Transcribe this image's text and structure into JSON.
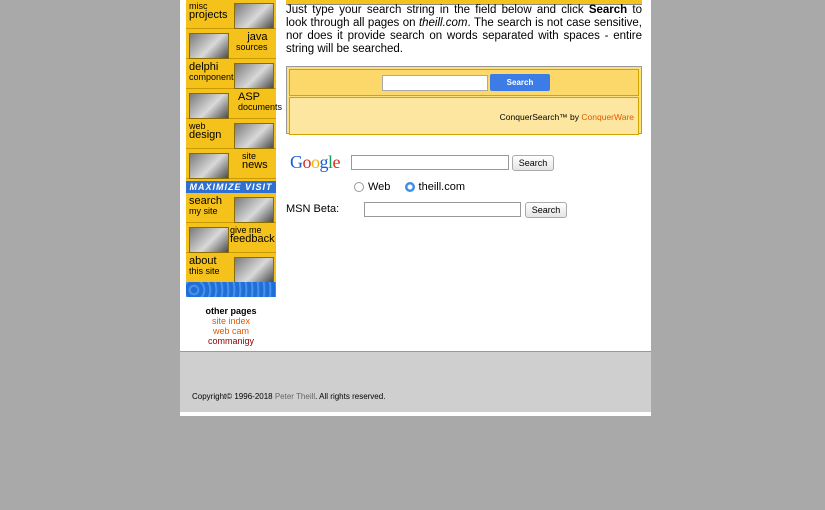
{
  "nav": {
    "items": [
      {
        "line1": "misc",
        "line2": "projects",
        "side": "left"
      },
      {
        "line1": "java",
        "line2": "sources",
        "side": "right"
      },
      {
        "line1": "delphi",
        "line2": "components",
        "side": "left"
      },
      {
        "line1": "ASP",
        "line2": "documents",
        "side": "right"
      },
      {
        "line1": "web",
        "line2": "design",
        "side": "left"
      },
      {
        "line1": "site",
        "line2": "news",
        "side": "right"
      }
    ],
    "banner": "MAXIMIZE VISIT",
    "items2": [
      {
        "line1": "search",
        "line2": "my site",
        "side": "left"
      },
      {
        "line1": "give me",
        "line2": "feedback",
        "side": "right"
      },
      {
        "line1": "about",
        "line2": "this site",
        "side": "left"
      }
    ]
  },
  "other_pages": {
    "title": "other pages",
    "links": [
      "site index",
      "web cam",
      "commanigy"
    ]
  },
  "intro": {
    "part1": "Just type your search string in the field below and click ",
    "bold": "Search",
    "part2": " to look through all pages on ",
    "italic": "theill.com",
    "part3": ". The search is not case sensitive, nor does it provide search on words separated with spaces - entire string will be searched."
  },
  "conquer": {
    "button": "Search",
    "credit_prefix": "ConquerSearch™ by ",
    "credit_brand": "ConquerWare"
  },
  "google": {
    "logo": "Google",
    "button": "Search",
    "radio_web": "Web",
    "radio_site": "theill.com",
    "selected": "theill.com"
  },
  "msn": {
    "label": "MSN Beta:",
    "button": "Search"
  },
  "footer": {
    "prefix": "Copyright© 1996-2018 ",
    "name": "Peter Theill",
    "suffix": ". All rights reserved."
  },
  "colors": {
    "background": "#a9a9a9",
    "nav_yellow": "#f4c21a",
    "accent_blue": "#3d7be6",
    "link_orange": "#e05a00"
  }
}
